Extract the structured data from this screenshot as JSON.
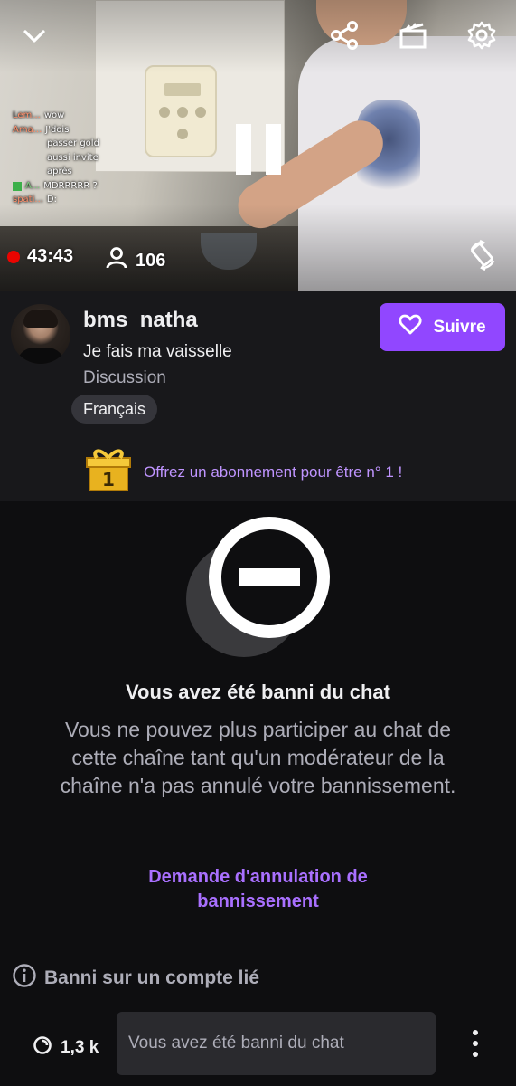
{
  "player": {
    "uptime": "43:43",
    "viewers": "106",
    "icons": {
      "collapse": "chevron-down-icon",
      "share": "share-icon",
      "clip": "clapperboard-icon",
      "settings": "gear-icon",
      "pause": "pause-icon",
      "rotate": "rotate-screen-icon",
      "viewers": "person-icon"
    },
    "chat_overlay": [
      {
        "user": "Lem...",
        "message": "wow"
      },
      {
        "user": "Ama...",
        "message": "J'dois"
      },
      {
        "user": "",
        "message": "passer gold"
      },
      {
        "user": "",
        "message": "aussi invite"
      },
      {
        "user": "",
        "message": "après"
      },
      {
        "user": "A...",
        "message": "MDRRRRR ?"
      },
      {
        "user": "spati...",
        "message": "D:"
      }
    ]
  },
  "channel": {
    "name": "bms_natha",
    "title": "Je fais ma vaisselle",
    "category": "Discussion",
    "tag": "Français",
    "follow_label": "Suivre",
    "gift_badge": "1",
    "gift_text": "Offrez un abonnement pour être n° 1 !"
  },
  "ban": {
    "title": "Vous avez été banni du chat",
    "description": "Vous ne pouvez plus participer au chat de cette chaîne tant qu'un modérateur de la chaîne n'a pas annulé votre bannissement.",
    "appeal_link": "Demande d'annulation de bannissement",
    "linked_account": "Banni sur un compte lié"
  },
  "chat_bar": {
    "points": "1,3 k",
    "input_placeholder": "Vous avez été banni du chat"
  },
  "colors": {
    "accent": "#9147ff",
    "link": "#a970ff",
    "live": "#eb0400",
    "background": "#0e0e10",
    "panel": "#18181b"
  }
}
